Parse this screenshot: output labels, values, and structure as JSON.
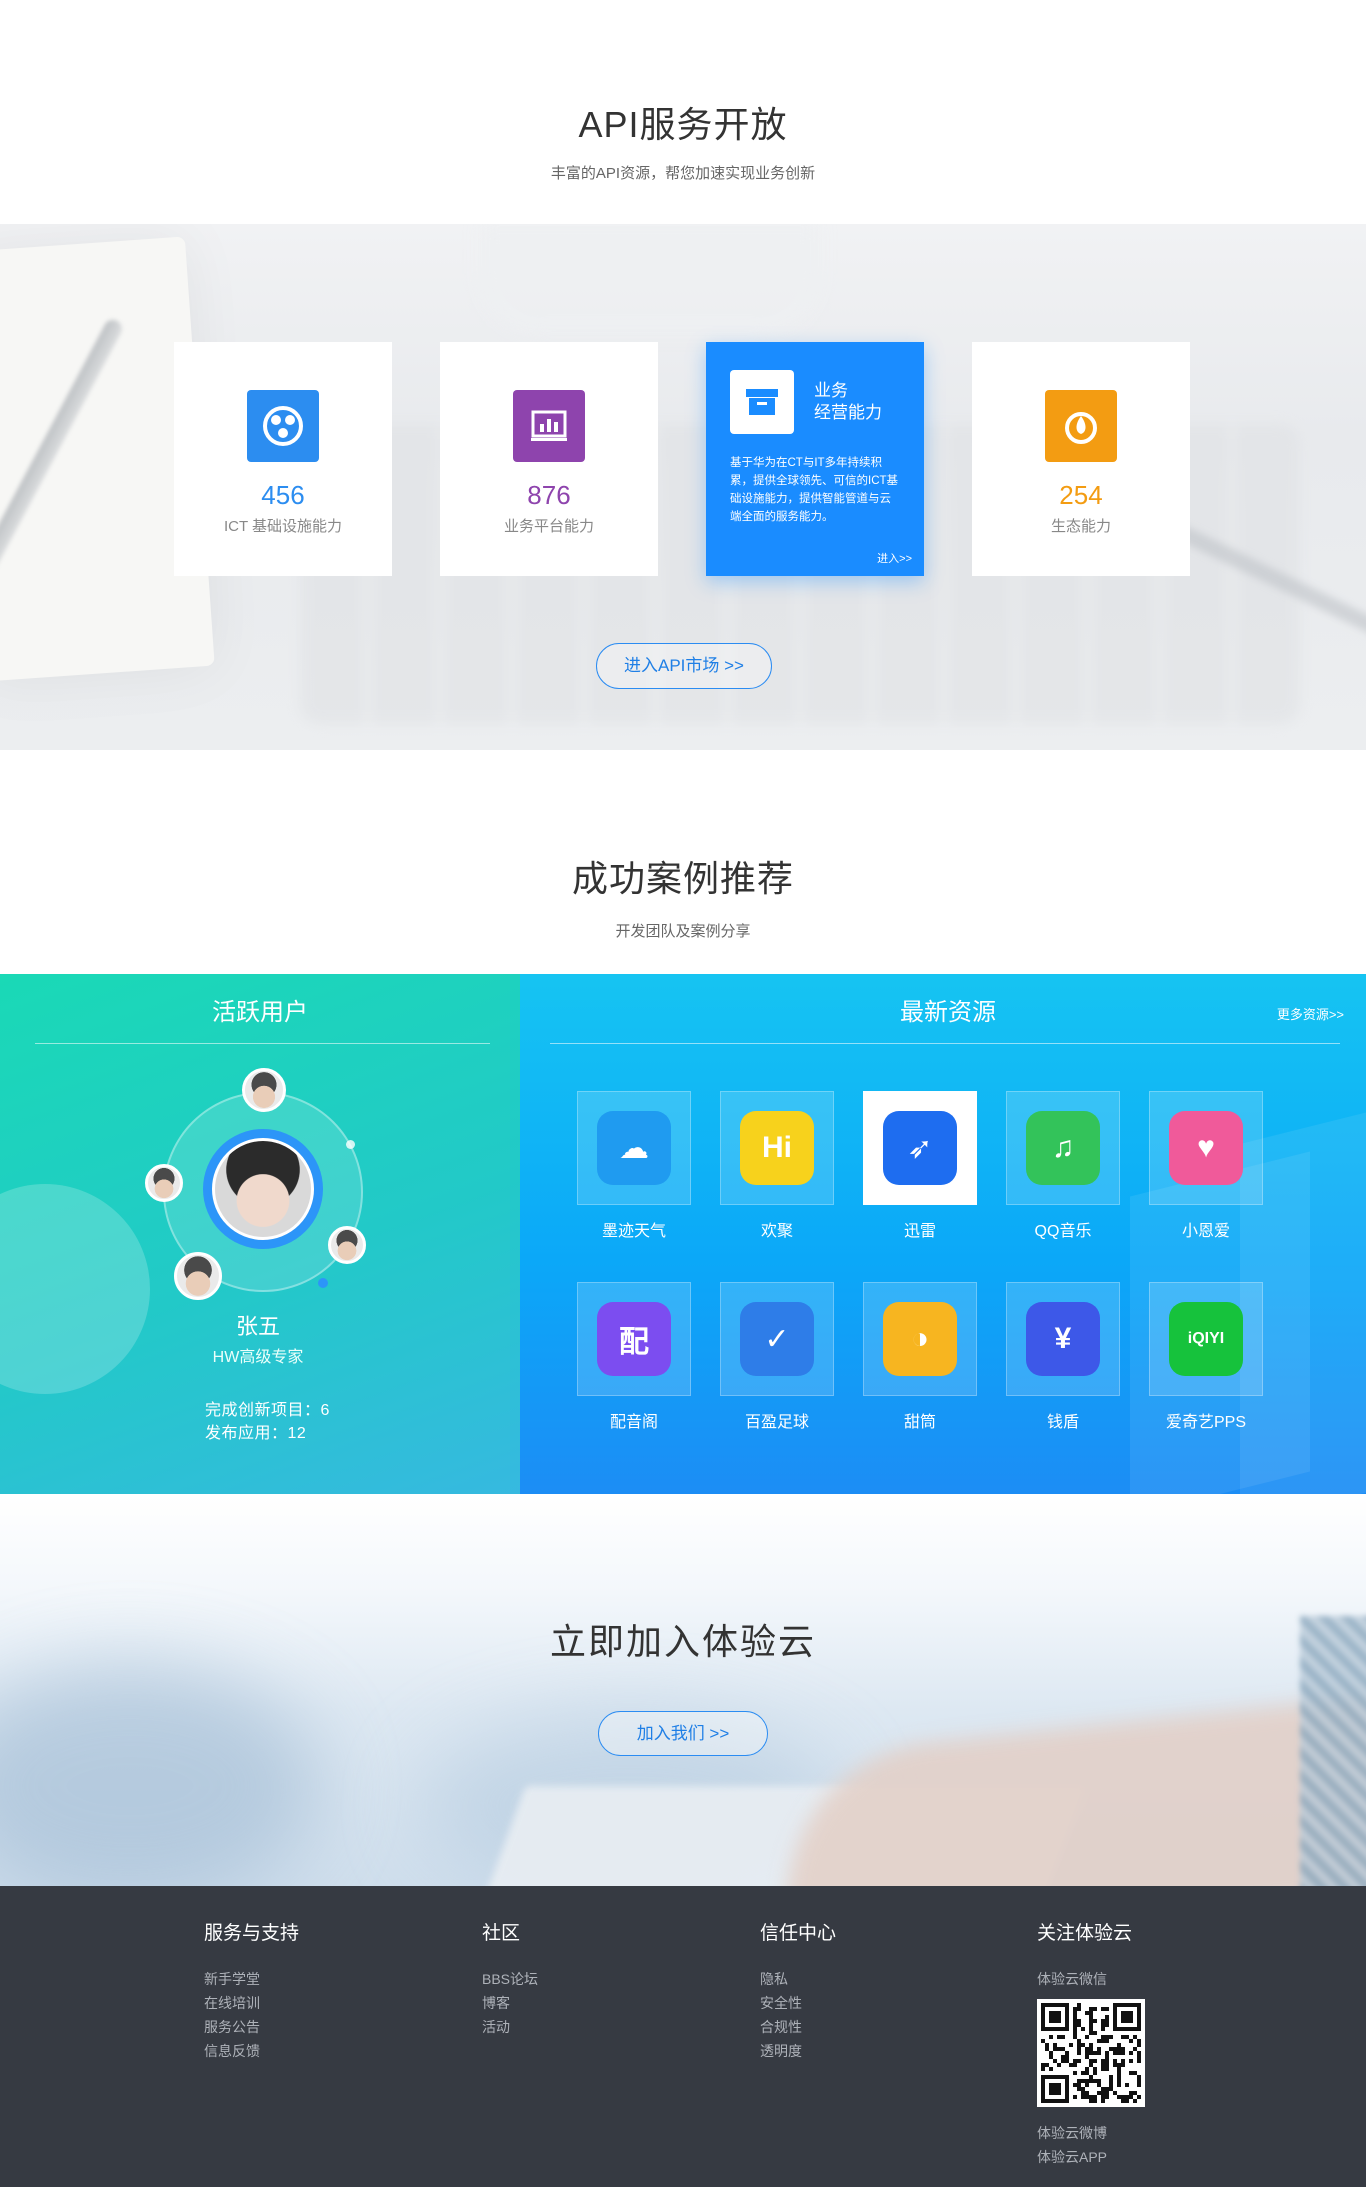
{
  "api": {
    "title": "API服务开放",
    "subtitle": "丰富的API资源，帮您加速实现业务创新",
    "cards": [
      {
        "count": "456",
        "label": "ICT 基础设施能力",
        "color": "#2c8df0",
        "icon": "network-sphere-icon"
      },
      {
        "count": "876",
        "label": "业务平台能力",
        "color": "#8e44ad",
        "icon": "chart-board-icon"
      },
      {
        "count": "254",
        "label": "生态能力",
        "color": "#f39c12",
        "icon": "eco-drop-icon"
      }
    ],
    "featured": {
      "title_line1": "业务",
      "title_line2": "经营能力",
      "description": "基于华为在CT与IT多年持续积累，提供全球领先、可信的ICT基础设施能力，提供智能管道与云端全面的服务能力。",
      "enter": "进入>>",
      "icon": "box-icon"
    },
    "market_button": "进入API市场 >>"
  },
  "cases": {
    "title": "成功案例推荐",
    "subtitle": "开发团队及案例分享",
    "active_users": {
      "title": "活跃用户",
      "name": "张五",
      "role": "HW高级专家",
      "projects": "完成创新项目：6",
      "apps": "发布应用：12"
    },
    "resources": {
      "title": "最新资源",
      "more": "更多资源>>",
      "apps": [
        {
          "name": "墨迹天气",
          "glyph": "☁",
          "color": "#1f9bf0"
        },
        {
          "name": "欢聚",
          "glyph": "Hi",
          "color": "#f7d21c"
        },
        {
          "name": "迅雷",
          "glyph": "➶",
          "color": "#1e6df0"
        },
        {
          "name": "QQ音乐",
          "glyph": "♫",
          "color": "#33c35a"
        },
        {
          "name": "小恩爱",
          "glyph": "♥",
          "color": "#f05a9a"
        },
        {
          "name": "配音阁",
          "glyph": "配",
          "color": "#7c4df0"
        },
        {
          "name": "百盈足球",
          "glyph": "✓",
          "color": "#2e7de8"
        },
        {
          "name": "甜筒",
          "glyph": "◑",
          "color": "#f7b520"
        },
        {
          "name": "钱盾",
          "glyph": "¥",
          "color": "#3d58e8"
        },
        {
          "name": "爱奇艺PPS",
          "glyph": "iQIYI",
          "color": "#16c23c"
        }
      ]
    }
  },
  "join": {
    "title": "立即加入体验云",
    "button": "加入我们 >>"
  },
  "footer": {
    "columns": [
      {
        "title": "服务与支持",
        "links": [
          "新手学堂",
          "在线培训",
          "服务公告",
          "信息反馈"
        ]
      },
      {
        "title": "社区",
        "links": [
          "BBS论坛",
          "博客",
          "活动"
        ]
      },
      {
        "title": "信任中心",
        "links": [
          "隐私",
          "安全性",
          "合规性",
          "透明度"
        ]
      }
    ],
    "follow": {
      "title": "关注体验云",
      "wechat": "体验云微信",
      "weibo": "体验云微博",
      "app": "体验云APP"
    }
  }
}
